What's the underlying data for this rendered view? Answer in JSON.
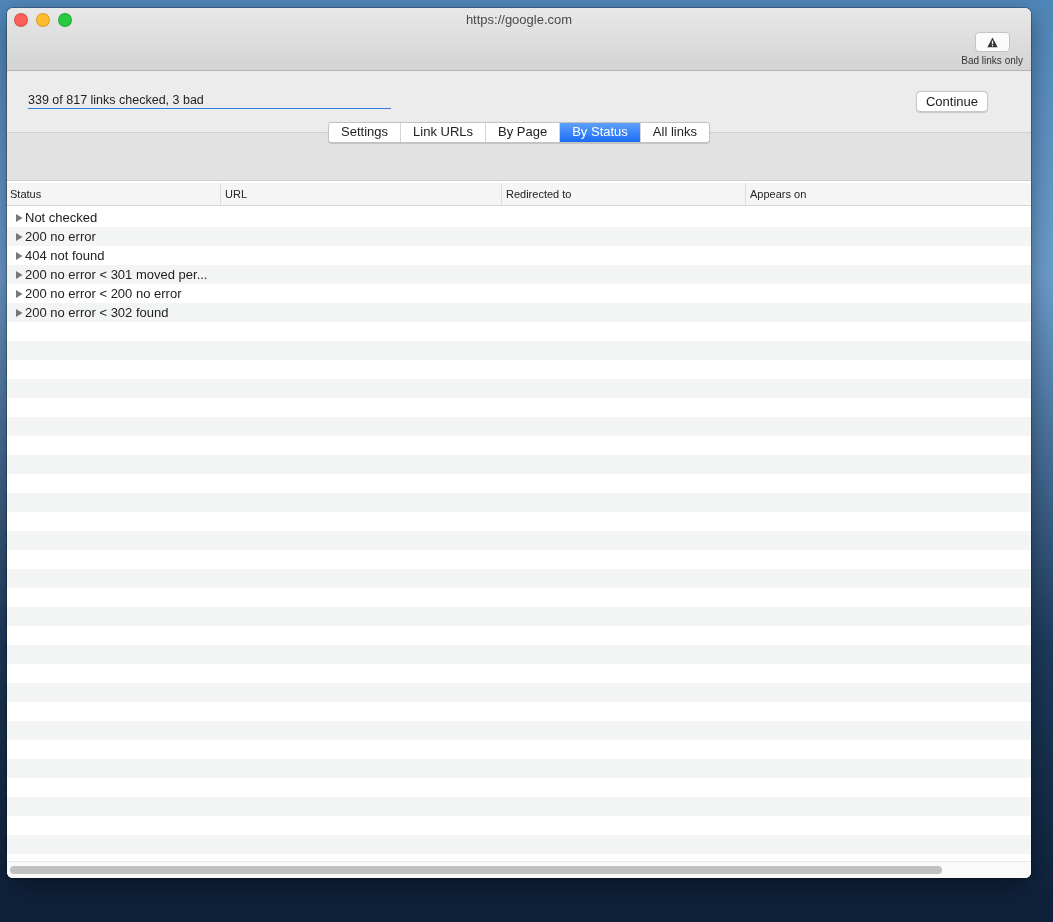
{
  "window": {
    "title": "https://google.com"
  },
  "toolbar": {
    "bad_links_button": {
      "label": "Bad links only"
    }
  },
  "progress": {
    "text": "339 of 817 links checked, 3 bad"
  },
  "continue_button": {
    "label": "Continue"
  },
  "tabs": [
    {
      "label": "Settings",
      "selected": false
    },
    {
      "label": "Link URLs",
      "selected": false
    },
    {
      "label": "By Page",
      "selected": false
    },
    {
      "label": "By Status",
      "selected": true
    },
    {
      "label": "All links",
      "selected": false
    }
  ],
  "table": {
    "columns": [
      "Status",
      "URL",
      "Redirected to",
      "Appears on"
    ],
    "rows": [
      {
        "status": "Not checked",
        "expanded": false
      },
      {
        "status": "200 no error",
        "expanded": false
      },
      {
        "status": "404 not found",
        "expanded": false
      },
      {
        "status": "200 no error < 301 moved per...",
        "expanded": false
      },
      {
        "status": "200 no error < 200 no error",
        "expanded": false
      },
      {
        "status": "200 no error < 302 found",
        "expanded": false
      }
    ]
  }
}
